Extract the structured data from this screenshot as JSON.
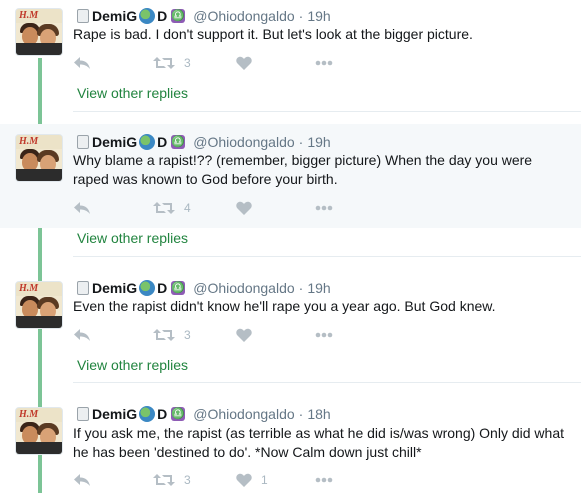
{
  "tweets": [
    {
      "name": "DemiG",
      "name_suffix": "D",
      "libra_symbol": "♎",
      "handle": "@Ohiodongaldo",
      "time": "19h",
      "text_lines": [
        "Rape is bad. I don't support it. But let's look at the bigger picture."
      ],
      "retweets": "3",
      "likes": "",
      "highlight": false
    },
    {
      "name": "DemiG",
      "name_suffix": "D",
      "libra_symbol": "♎",
      "handle": "@Ohiodongaldo",
      "time": "19h",
      "text_lines": [
        "Why blame a rapist!?? (remember, bigger picture) When the day you were",
        "raped was known to God before your birth."
      ],
      "retweets": "4",
      "likes": "",
      "highlight": true
    },
    {
      "name": "DemiG",
      "name_suffix": "D",
      "libra_symbol": "♎",
      "handle": "@Ohiodongaldo",
      "time": "19h",
      "text_lines": [
        "Even the rapist didn't know he'll rape you a year ago. But God knew."
      ],
      "retweets": "3",
      "likes": "",
      "highlight": false
    },
    {
      "name": "DemiG",
      "name_suffix": "D",
      "libra_symbol": "♎",
      "handle": "@Ohiodongaldo",
      "time": "18h",
      "text_lines": [
        "If you ask me, the rapist (as terrible as what he did is/was wrong) Only did what",
        "he has been 'destined to do'.  *Now Calm down just chill*"
      ],
      "retweets": "3",
      "likes": "1",
      "highlight": false
    }
  ],
  "view_other_replies": "View other replies",
  "separator_dot": "·",
  "avatar_logo": "H.M",
  "icons": {
    "reply": "reply-icon",
    "retweet": "retweet-icon",
    "like": "heart-icon",
    "more": "more-icon"
  },
  "colors": {
    "thread_line": "#7cc496",
    "link": "#21843f",
    "muted": "#657786",
    "icon": "#b5bec5",
    "highlight_bg": "#f5f8fa"
  }
}
